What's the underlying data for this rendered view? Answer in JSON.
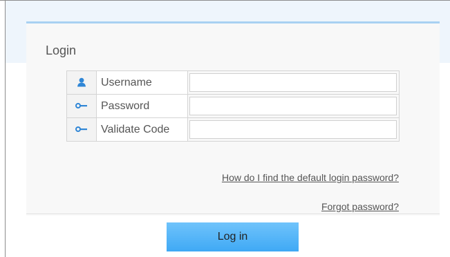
{
  "panel": {
    "title": "Login"
  },
  "form": {
    "rows": [
      {
        "icon": "user-icon",
        "label": "Username",
        "value": ""
      },
      {
        "icon": "key-icon",
        "label": "Password",
        "value": ""
      },
      {
        "icon": "key-icon",
        "label": "Validate Code",
        "value": ""
      }
    ]
  },
  "links": {
    "default_password": "How do I find the default login password?",
    "forgot_password": "Forgot password?"
  },
  "actions": {
    "login_label": "Log in"
  },
  "colors": {
    "accent": "#3fa9f5",
    "panel_border": "#a8d1f2",
    "icon": "#2f86d6"
  }
}
